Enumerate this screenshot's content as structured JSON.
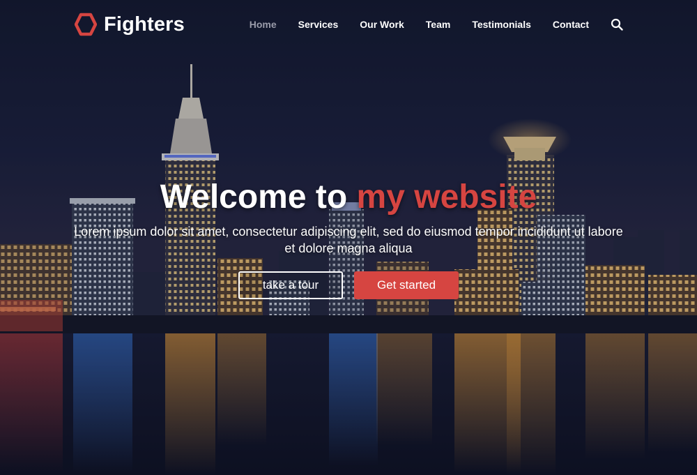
{
  "brand": {
    "name": "Fighters",
    "logo_icon": "hexagon-icon",
    "accent_color": "#d64541"
  },
  "nav": {
    "items": [
      {
        "label": "Home",
        "active": true
      },
      {
        "label": "Services",
        "active": false
      },
      {
        "label": "Our Work",
        "active": false
      },
      {
        "label": "Team",
        "active": false
      },
      {
        "label": "Testimonials",
        "active": false
      },
      {
        "label": "Contact",
        "active": false
      }
    ],
    "search_icon": "search-icon"
  },
  "hero": {
    "title_lead": "Welcome to",
    "title_accent": "my website",
    "subtitle": "Lorem ipsum dolor sit amet, consectetur adipiscing elit, sed do eiusmod tempor incididunt ut labore et dolore magna aliqua",
    "primary_button": "Get started",
    "secondary_button": "take a tour"
  }
}
